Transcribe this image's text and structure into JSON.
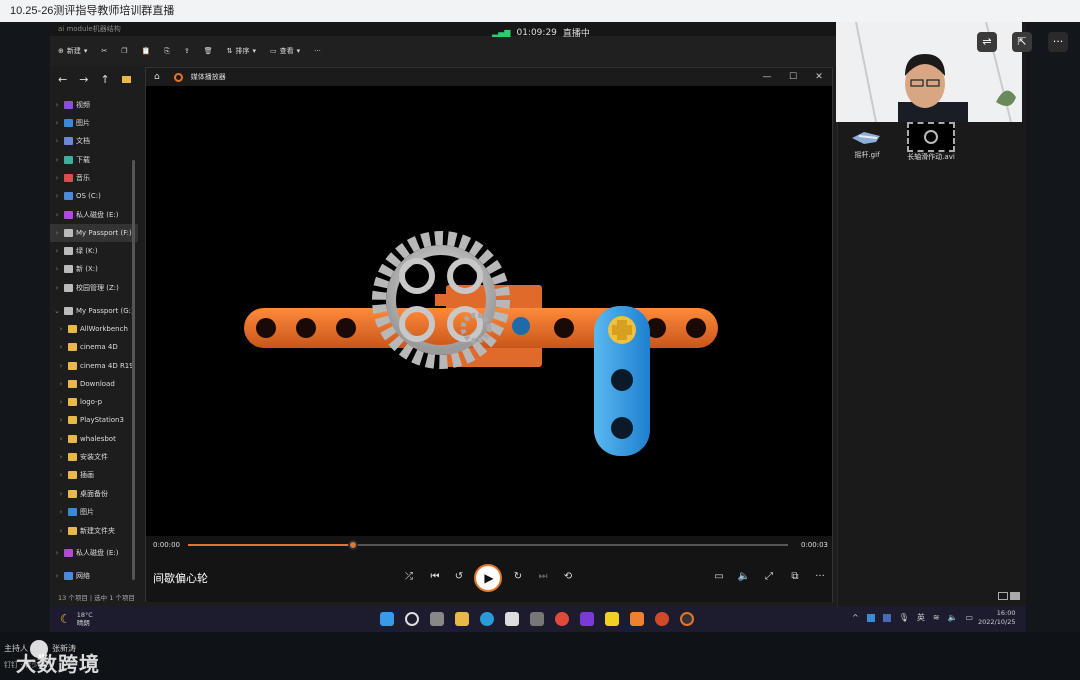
{
  "window_title": "10.25-26测评指导教师培训群直播",
  "live": {
    "time": "01:09:29",
    "label": "直播中",
    "accent": "#2ecc71"
  },
  "explorer": {
    "title": "ai module机器结构",
    "toolbar": {
      "new": "新建",
      "sort": "排序",
      "view": "查看"
    },
    "tree": [
      {
        "label": "视频",
        "color": "#8a4fd8"
      },
      {
        "label": "图片",
        "color": "#3a8ad8"
      },
      {
        "label": "文档",
        "color": "#6a8ad8"
      },
      {
        "label": "下载",
        "color": "#3ab0a0"
      },
      {
        "label": "音乐",
        "color": "#e04a4a"
      },
      {
        "label": "OS (C:)",
        "color": "#4a8ad8"
      },
      {
        "label": "私人磁盘 (E:)",
        "color": "#b04ad8"
      },
      {
        "label": "My Passport (F:)",
        "color": "#bbbbbb",
        "selected": true
      },
      {
        "label": "绿 (K:)",
        "color": "#bbbbbb"
      },
      {
        "label": "新 (X:)",
        "color": "#bbbbbb"
      },
      {
        "label": "校园管理 (Z:)",
        "color": "#bbbbbb"
      },
      {
        "label": "My Passport (G:)",
        "color": "#bbbbbb",
        "expanded": true
      },
      {
        "label": "AllWorkbench",
        "color": "#e8b84a"
      },
      {
        "label": "cinema 4D",
        "color": "#e8b84a"
      },
      {
        "label": "cinema 4D R19",
        "color": "#e8b84a"
      },
      {
        "label": "Download",
        "color": "#e8b84a"
      },
      {
        "label": "logo-p",
        "color": "#e8b84a"
      },
      {
        "label": "PlayStation3",
        "color": "#e8b84a"
      },
      {
        "label": "whalesbot",
        "color": "#e8b84a"
      },
      {
        "label": "安装文件",
        "color": "#e8b84a"
      },
      {
        "label": "插画",
        "color": "#e8b84a"
      },
      {
        "label": "桌面备份",
        "color": "#e8b84a"
      },
      {
        "label": "图片",
        "color": "#3a8ad8"
      },
      {
        "label": "新建文件夹",
        "color": "#e8b84a"
      },
      {
        "label": "私人磁盘 (E:)",
        "color": "#b04ad8"
      },
      {
        "label": "网络",
        "color": "#4a8ad8"
      }
    ],
    "status": "13 个项目  |  选中 1 个项目"
  },
  "player": {
    "app_name": "媒体播放器",
    "current_time": "0:00:00",
    "total_time": "0:00:03",
    "progress": 0.275,
    "video_title": "间歇偏心轮",
    "accent": "#e2762d"
  },
  "files": [
    {
      "name": "摇杆.gif"
    },
    {
      "name": "长轴滑作动.avi"
    }
  ],
  "taskbar": {
    "weather_temp": "18°C",
    "weather_desc": "晴朗",
    "ime": "英",
    "clock_time": "16:00",
    "clock_date": "2022/10/25"
  },
  "overlay": {
    "host_label": "主持人",
    "host_name": "张新涛",
    "sub_label": "钉钉 · 青少年...",
    "watermark": "大数跨境"
  }
}
